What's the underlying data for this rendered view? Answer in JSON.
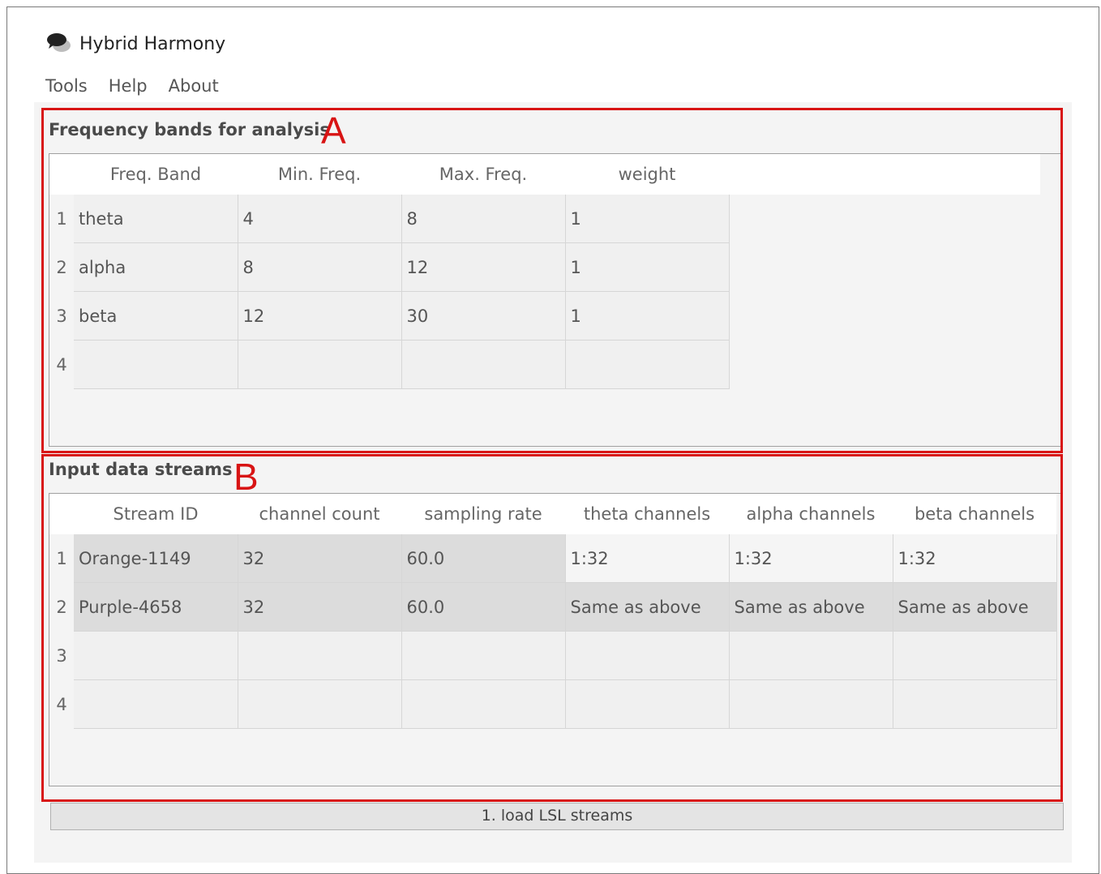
{
  "app": {
    "title": "Hybrid Harmony",
    "icon": "speech-bubbles-icon"
  },
  "menu": {
    "items": [
      "Tools",
      "Help",
      "About"
    ]
  },
  "annotations": {
    "a": "A",
    "b": "B",
    "color": "#d81414"
  },
  "freq_section": {
    "title": "Frequency bands for analysis",
    "columns": [
      "Freq. Band",
      "Min. Freq.",
      "Max. Freq.",
      "weight"
    ],
    "row_numbers": [
      "1",
      "2",
      "3",
      "4"
    ],
    "rows": [
      [
        "theta",
        "4",
        "8",
        "1"
      ],
      [
        "alpha",
        "8",
        "12",
        "1"
      ],
      [
        "beta",
        "12",
        "30",
        "1"
      ],
      [
        "",
        "",
        "",
        ""
      ]
    ]
  },
  "streams_section": {
    "title": "Input data streams",
    "columns": [
      "Stream ID",
      "channel count",
      "sampling rate",
      "theta channels",
      "alpha channels",
      "beta channels"
    ],
    "row_numbers": [
      "1",
      "2",
      "3",
      "4"
    ],
    "rows": [
      [
        "Orange-1149",
        "32",
        "60.0",
        "1:32",
        "1:32",
        "1:32"
      ],
      [
        "Purple-4658",
        "32",
        "60.0",
        "Same as above",
        "Same as above",
        "Same as above"
      ],
      [
        "",
        "",
        "",
        "",
        "",
        ""
      ],
      [
        "",
        "",
        "",
        "",
        "",
        ""
      ]
    ]
  },
  "load_button": {
    "label": "1. load LSL streams"
  }
}
